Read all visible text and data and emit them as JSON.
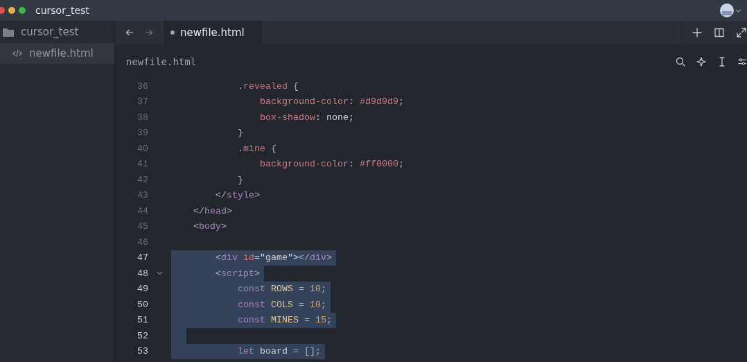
{
  "window": {
    "title": "cursor_test"
  },
  "sidebar": {
    "folder": "cursor_test",
    "items": [
      {
        "label": "newfile.html",
        "selected": true
      }
    ]
  },
  "tabs": [
    {
      "label": "newfile.html",
      "selected": true
    }
  ],
  "breadcrumb": "newfile.html",
  "editor": {
    "lines": [
      {
        "number": "36",
        "selected": false,
        "fold": false,
        "tokens": [
          {
            "text": "            .",
            "kind": "punct"
          },
          {
            "text": "revealed",
            "kind": "selector"
          },
          {
            "text": " {",
            "kind": "punct"
          }
        ]
      },
      {
        "number": "37",
        "selected": false,
        "fold": false,
        "tokens": [
          {
            "text": "                background-color",
            "kind": "prop"
          },
          {
            "text": ": ",
            "kind": "punct"
          },
          {
            "text": "#d9d9d9",
            "kind": "prop"
          },
          {
            "text": ";",
            "kind": "punct"
          }
        ]
      },
      {
        "number": "38",
        "selected": false,
        "fold": false,
        "tokens": [
          {
            "text": "                box-shadow",
            "kind": "prop"
          },
          {
            "text": ": none;",
            "kind": "plain"
          }
        ]
      },
      {
        "number": "39",
        "selected": false,
        "fold": false,
        "tokens": [
          {
            "text": "            }",
            "kind": "punct"
          }
        ]
      },
      {
        "number": "40",
        "selected": false,
        "fold": false,
        "tokens": [
          {
            "text": "            .",
            "kind": "punct"
          },
          {
            "text": "mine",
            "kind": "selector"
          },
          {
            "text": " {",
            "kind": "punct"
          }
        ]
      },
      {
        "number": "41",
        "selected": false,
        "fold": false,
        "tokens": [
          {
            "text": "                background-color",
            "kind": "prop"
          },
          {
            "text": ": ",
            "kind": "punct"
          },
          {
            "text": "#ff0000",
            "kind": "prop"
          },
          {
            "text": ";",
            "kind": "punct"
          }
        ]
      },
      {
        "number": "42",
        "selected": false,
        "fold": false,
        "tokens": [
          {
            "text": "            }",
            "kind": "punct"
          }
        ]
      },
      {
        "number": "43",
        "selected": false,
        "fold": false,
        "tokens": [
          {
            "text": "        </",
            "kind": "punct"
          },
          {
            "text": "style",
            "kind": "tag"
          },
          {
            "text": ">",
            "kind": "punct"
          }
        ]
      },
      {
        "number": "44",
        "selected": false,
        "fold": false,
        "tokens": [
          {
            "text": "    </",
            "kind": "punct"
          },
          {
            "text": "head",
            "kind": "tag"
          },
          {
            "text": ">",
            "kind": "punct"
          }
        ]
      },
      {
        "number": "45",
        "selected": false,
        "fold": false,
        "tokens": [
          {
            "text": "    <",
            "kind": "punct"
          },
          {
            "text": "body",
            "kind": "tag"
          },
          {
            "text": ">",
            "kind": "punct"
          }
        ]
      },
      {
        "number": "46",
        "selected": false,
        "fold": false
      },
      {
        "number": "47",
        "selected": true,
        "fold": false,
        "tokens": [
          {
            "text": "        <",
            "kind": "punct"
          },
          {
            "text": "div",
            "kind": "tag"
          },
          {
            "text": " id",
            "kind": "attr"
          },
          {
            "text": "=\"game\">",
            "kind": "plain"
          },
          {
            "text": "</",
            "kind": "punct"
          },
          {
            "text": "div",
            "kind": "tag"
          },
          {
            "text": ">",
            "kind": "punct"
          }
        ]
      },
      {
        "number": "48",
        "selected": true,
        "fold": true,
        "tokens": [
          {
            "text": "        <",
            "kind": "punct"
          },
          {
            "text": "script",
            "kind": "tag"
          },
          {
            "text": ">",
            "kind": "punct"
          }
        ]
      },
      {
        "number": "49",
        "selected": true,
        "fold": false,
        "tokens": [
          {
            "text": "            const",
            "kind": "keyword"
          },
          {
            "text": " ROWS",
            "kind": "const"
          },
          {
            "text": " = ",
            "kind": "punct"
          },
          {
            "text": "10",
            "kind": "num"
          },
          {
            "text": ";",
            "kind": "punct"
          }
        ]
      },
      {
        "number": "50",
        "selected": true,
        "fold": false,
        "tokens": [
          {
            "text": "            const",
            "kind": "keyword"
          },
          {
            "text": " COLS",
            "kind": "const"
          },
          {
            "text": " = ",
            "kind": "punct"
          },
          {
            "text": "10",
            "kind": "num"
          },
          {
            "text": ";",
            "kind": "punct"
          }
        ]
      },
      {
        "number": "51",
        "selected": true,
        "fold": false,
        "tokens": [
          {
            "text": "            const",
            "kind": "keyword"
          },
          {
            "text": " MINES",
            "kind": "const"
          },
          {
            "text": " = ",
            "kind": "punct"
          },
          {
            "text": "15",
            "kind": "num"
          },
          {
            "text": ";",
            "kind": "punct"
          }
        ]
      },
      {
        "number": "52",
        "selected": true,
        "fold": false
      },
      {
        "number": "53",
        "selected": true,
        "fold": false,
        "tokens": [
          {
            "text": "            let",
            "kind": "keyword"
          },
          {
            "text": " board ",
            "kind": "plain"
          },
          {
            "text": "= [];",
            "kind": "punct"
          }
        ]
      }
    ]
  }
}
